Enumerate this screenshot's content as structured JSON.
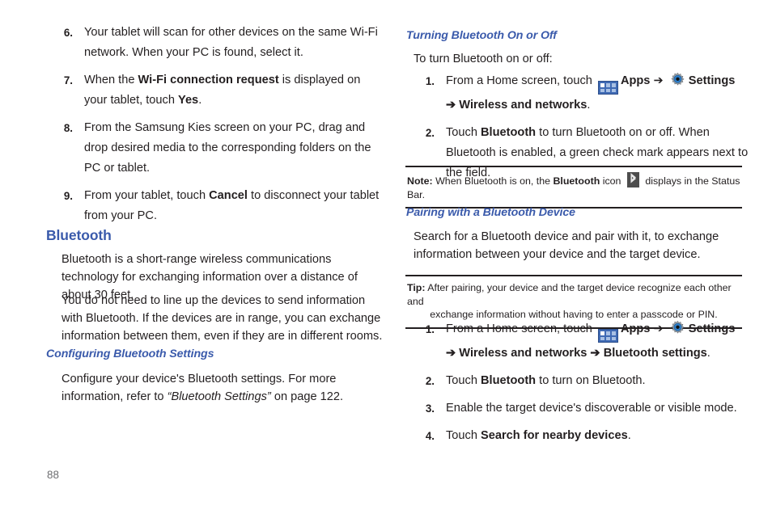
{
  "page": {
    "number": "88"
  },
  "left_column": {
    "steps_continued": [
      {
        "num": "6.",
        "parts": [
          {
            "t": "Your tablet will scan for other devices on the same Wi-Fi network. When your PC is found, select it.",
            "b": false
          }
        ]
      },
      {
        "num": "7.",
        "parts": [
          {
            "t": "When the ",
            "b": false
          },
          {
            "t": "Wi-Fi connection request",
            "b": true
          },
          {
            "t": " is displayed on your tablet, touch ",
            "b": false
          },
          {
            "t": "Yes",
            "b": true
          },
          {
            "t": ".",
            "b": false
          }
        ]
      },
      {
        "num": "8.",
        "parts": [
          {
            "t": "From the Samsung Kies screen on your PC, drag and drop desired media to the corresponding folders on the PC or tablet.",
            "b": false
          }
        ]
      },
      {
        "num": "9.",
        "parts": [
          {
            "t": "From your tablet, touch ",
            "b": false
          },
          {
            "t": "Cancel",
            "b": true
          },
          {
            "t": " to disconnect your tablet from your PC.",
            "b": false
          }
        ]
      }
    ],
    "bluetooth_heading": "Bluetooth",
    "bluetooth_para_1": "Bluetooth is a short-range wireless communications technology for exchanging information over a distance of about 30 feet.",
    "bluetooth_para_2": "You do not need to line up the devices to send information with Bluetooth. If the devices are in range, you can exchange information between them, even if they are in different rooms.",
    "configuring_heading": "Configuring Bluetooth Settings",
    "configuring_para": {
      "lead": "Configure your device's Bluetooth settings. For more information, refer to ",
      "ref": "“Bluetooth Settings”",
      "tail": "  on page 122."
    }
  },
  "right_column": {
    "turning_heading": "Turning Bluetooth On or Off",
    "turning_intro": "To turn Bluetooth on or off:",
    "turning_steps": [
      {
        "num": "1.",
        "lead": "From a Home screen, touch ",
        "apps_label": "Apps",
        "arrow_1": "➔",
        "settings_label": "Settings",
        "arrow_2": "➔",
        "path_label": "Wireless and networks",
        "tail": "."
      },
      {
        "num": "2.",
        "parts": [
          {
            "t": "Touch ",
            "b": false
          },
          {
            "t": "Bluetooth",
            "b": true
          },
          {
            "t": " to turn Bluetooth on or off. When Bluetooth is enabled, a green check mark appears next to the field.",
            "b": false
          }
        ]
      }
    ],
    "note": {
      "label": "Note:",
      "text_before": " When Bluetooth is on, the ",
      "bold_word": "Bluetooth",
      "text_mid": " icon ",
      "icon_name": "bluetooth-status-icon",
      "text_after": " displays in the Status Bar."
    },
    "pairing_heading": "Pairing with a Bluetooth Device",
    "pairing_para": "Search for a Bluetooth device and pair with it, to exchange information between your device and the target device.",
    "tip": {
      "label": "Tip:",
      "line1": " After pairing, your device and the target device recognize each other and",
      "line2": "exchange information without having to enter a passcode or PIN."
    },
    "pairing_steps": [
      {
        "num": "1.",
        "lead": "From a Home screen, touch ",
        "apps_label": "Apps",
        "arrow_1": "➔",
        "settings_label": "Settings",
        "arrow_2": "➔",
        "path_label": "Wireless and networks",
        "arrow_3": "➔",
        "path_label_2": "Bluetooth settings",
        "tail": "."
      },
      {
        "num": "2.",
        "parts": [
          {
            "t": "Touch ",
            "b": false
          },
          {
            "t": "Bluetooth",
            "b": true
          },
          {
            "t": " to turn on Bluetooth.",
            "b": false
          }
        ]
      },
      {
        "num": "3.",
        "parts": [
          {
            "t": "Enable the target device's discoverable or visible mode.",
            "b": false
          }
        ]
      },
      {
        "num": "4.",
        "parts": [
          {
            "t": "Touch ",
            "b": false
          },
          {
            "t": "Search for nearby devices",
            "b": true
          },
          {
            "t": ".",
            "b": false
          }
        ]
      }
    ]
  },
  "colors": {
    "heading_blue": "#3a5aab",
    "body_black": "#231f20",
    "folio_gray": "#6d6e71",
    "apps_icon_blue": "#3f6ab4",
    "gear_blue": "#2f7fc9"
  }
}
